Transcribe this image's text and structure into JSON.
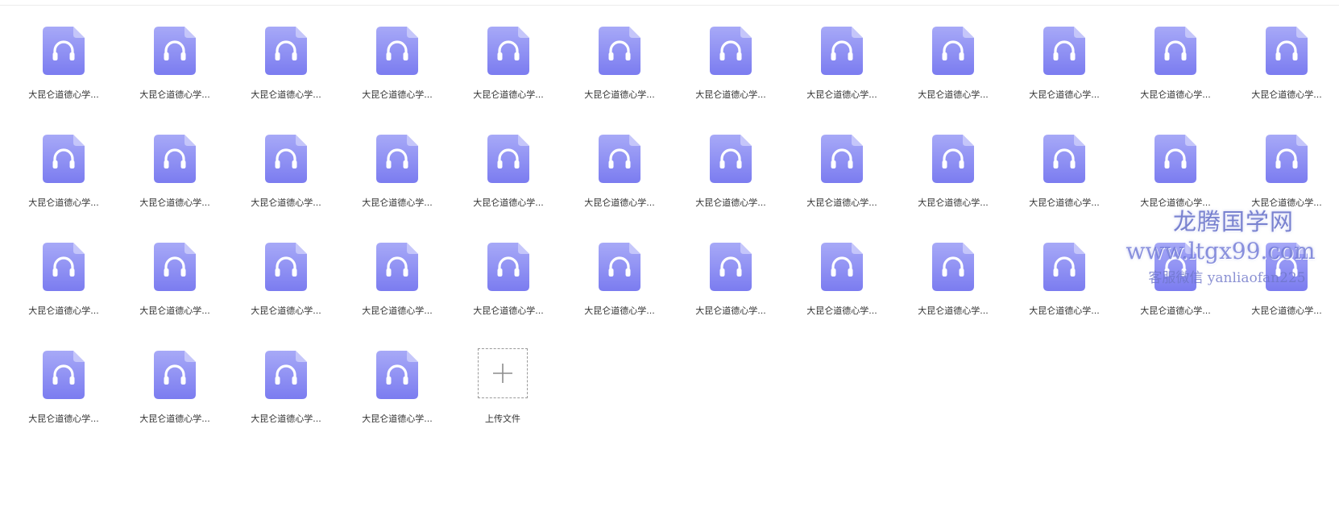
{
  "file_name": "大昆仑道德心学...",
  "file_count": 40,
  "file_icon_name": "audio-headphones-icon",
  "colors": {
    "file_icon_top": "#a7a9f7",
    "file_icon_bottom": "#7b7cf0",
    "text": "#333333",
    "watermark": "#6470c8"
  },
  "upload": {
    "label": "上传文件",
    "icon_name": "plus-icon"
  },
  "watermark": {
    "title": "龙腾国学网",
    "url": "www.ltgx99.com",
    "contact": "客服微信 yanliaofan225"
  }
}
